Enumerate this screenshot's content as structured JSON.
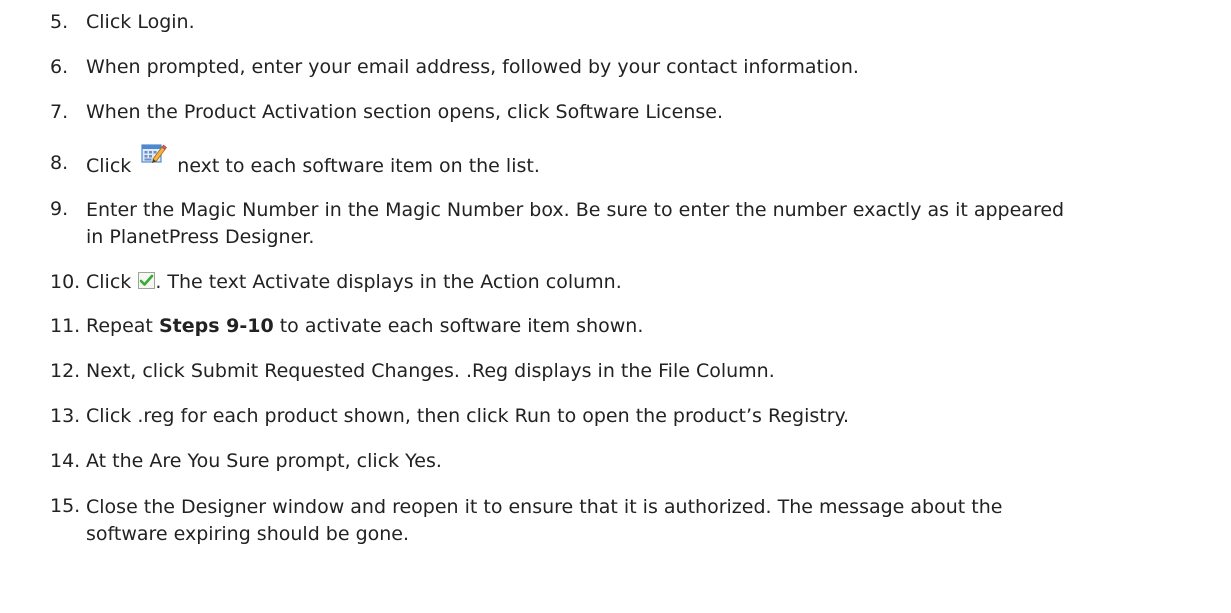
{
  "steps": [
    {
      "number": "5.",
      "text": "Click Login."
    },
    {
      "number": "6.",
      "text": "When prompted, enter your email address, followed by your contact information."
    },
    {
      "number": "7.",
      "text": "When the Product Activation section opens, click Software License."
    },
    {
      "number": "8.",
      "before": "Click",
      "icon": "edit-icon",
      "after": "next to each software item on the list."
    },
    {
      "number": "9.",
      "line1": "Enter the Magic Number in the Magic Number box. Be sure to enter the number exactly as it appeared",
      "line2": "in PlanetPress Designer."
    },
    {
      "number": "10.",
      "before": "Click",
      "icon": "green-checkmark-icon",
      "after": ". The text Activate displays in the Action column."
    },
    {
      "number": "11.",
      "before": "Repeat",
      "bold": "Steps 9-10",
      "after": "to activate each software item shown."
    },
    {
      "number": "12.",
      "text": "Next, click Submit Requested Changes. .Reg displays in the File Column."
    },
    {
      "number": "13.",
      "text": "Click .reg for each product shown, then click Run to open the product’s Registry."
    },
    {
      "number": "14.",
      "text": "At the Are You Sure prompt, click Yes."
    },
    {
      "number": "15.",
      "line1": "Close the Designer window and reopen it to ensure that it is authorized. The message about the",
      "line2": "software expiring should be gone."
    }
  ],
  "colors": {
    "text": "#222222",
    "check_green": "#3aa935",
    "edit_blue": "#4f8ad0"
  }
}
